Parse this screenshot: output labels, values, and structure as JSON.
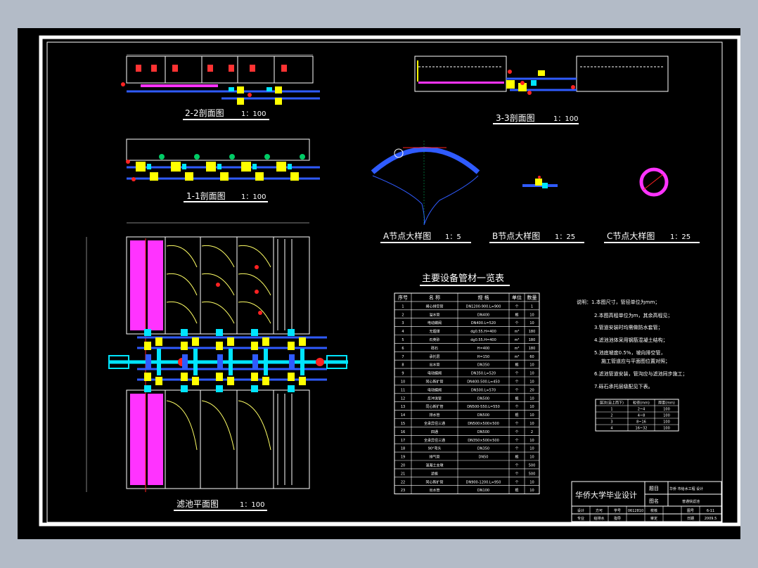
{
  "colors": {
    "background": "#000000",
    "frame": "#ffffff",
    "pipe_blue": "#2f5bff",
    "pipe_cyan": "#00e5ff",
    "valve_yellow": "#ffff00",
    "media_magenta": "#ff33ff",
    "marker_red": "#ff2020",
    "marker_green": "#00cc66",
    "curve_yellow": "#ffff66",
    "outer_bg": "#b3bbc7"
  },
  "drawings": {
    "section22": {
      "title": "2-2剖面图",
      "scale": "1：100"
    },
    "section33": {
      "title": "3-3剖面图",
      "scale": "1：100"
    },
    "section11": {
      "title": "1-1剖面图",
      "scale": "1：100"
    },
    "detailA": {
      "title": "A节点大样图",
      "scale": "1：5"
    },
    "detailB": {
      "title": "B节点大样图",
      "scale": "1：25"
    },
    "detailC": {
      "title": "C节点大样图",
      "scale": "1：25"
    },
    "plan": {
      "title": "滤池平面图",
      "scale": "1：100"
    }
  },
  "table": {
    "title": "主要设备管材一览表",
    "headers": [
      "序号",
      "名 称",
      "规 格",
      "单位",
      "数量"
    ],
    "rows": [
      [
        "1",
        "闸心排空管",
        "DN1200-900.L=900",
        "个",
        "1"
      ],
      [
        "2",
        "溢水管",
        "DN400",
        "根",
        "10"
      ],
      [
        "3",
        "电动蝶阀",
        "DN400.L=520",
        "个",
        "10"
      ],
      [
        "4",
        "无烟煤",
        "dg0.55.H=400",
        "m³",
        "180"
      ],
      [
        "5",
        "石英砂",
        "dg0.55.H=400",
        "m³",
        "180"
      ],
      [
        "6",
        "砾石",
        "H=400",
        "m³",
        "180"
      ],
      [
        "7",
        "承托层",
        "H=150",
        "m³",
        "60"
      ],
      [
        "8",
        "出水管",
        "DN350",
        "根",
        "10"
      ],
      [
        "9",
        "电动蝶阀",
        "DN350.L=520",
        "个",
        "10"
      ],
      [
        "10",
        "同心新扩管",
        "DN400-500.L=450",
        "个",
        "10"
      ],
      [
        "11",
        "电动蝶阀",
        "DN500.L=570",
        "个",
        "20"
      ],
      [
        "12",
        "反冲洗管",
        "DN500",
        "根",
        "10"
      ],
      [
        "13",
        "同心新扩管",
        "DN500-550.L=550",
        "个",
        "10"
      ],
      [
        "14",
        "排水管",
        "DN500",
        "根",
        "10"
      ],
      [
        "15",
        "全承异径三通",
        "DN500×500×500",
        "个",
        "10"
      ],
      [
        "16",
        "四通",
        "DN500",
        "个",
        "2"
      ],
      [
        "17",
        "全承异径三通",
        "DN350×500×500",
        "个",
        "10"
      ],
      [
        "18",
        "90°弯头",
        "DN350",
        "个",
        "10"
      ],
      [
        "19",
        "排气管",
        "DN50",
        "根",
        "10"
      ],
      [
        "20",
        "混凝土支墩",
        "",
        "个",
        "500"
      ],
      [
        "21",
        "滤板",
        "",
        "个",
        "500"
      ],
      [
        "22",
        "同心新扩管",
        "DN900-1200.L=950",
        "个",
        "10"
      ],
      [
        "23",
        "出水管",
        "DN100",
        "根",
        "10"
      ]
    ]
  },
  "notes": {
    "lines": [
      "说明：1.本图尺寸，管径单位为mm；",
      "2.本图高程单位为m，其余高程见；",
      "3.管道安装时均需做防水套管；",
      "4.滤池池体采用钢筋混凝土结构；",
      "5.池底坡度0.5%，坡向排空管，",
      "施工管道应与平面图位置对照；",
      "6.滤池管道安装，管沟应与滤池同步施工；",
      "7.砾石承托层级配见下表。"
    ],
    "gravel_table": {
      "headers": [
        "层次(自上而下)",
        "粒径(mm)",
        "厚度(mm)"
      ],
      "rows": [
        [
          "1",
          "2~4",
          "100"
        ],
        [
          "2",
          "4~8",
          "100"
        ],
        [
          "3",
          "8~16",
          "100"
        ],
        [
          "4",
          "16~32",
          "100"
        ]
      ]
    }
  },
  "title_block": {
    "school": "华侨大学毕业设计",
    "label_project": "题目",
    "project": "华侨 市给水工程 设计",
    "label_drawing": "图名",
    "drawing": "普通快滤池",
    "row1": [
      "设计",
      "方可",
      "学号",
      "0612810",
      "校核",
      "",
      "图号",
      "6-11"
    ],
    "row2": [
      "专业",
      "给排水",
      "指导",
      "",
      "审定",
      "",
      "日期",
      "2009.5"
    ]
  }
}
